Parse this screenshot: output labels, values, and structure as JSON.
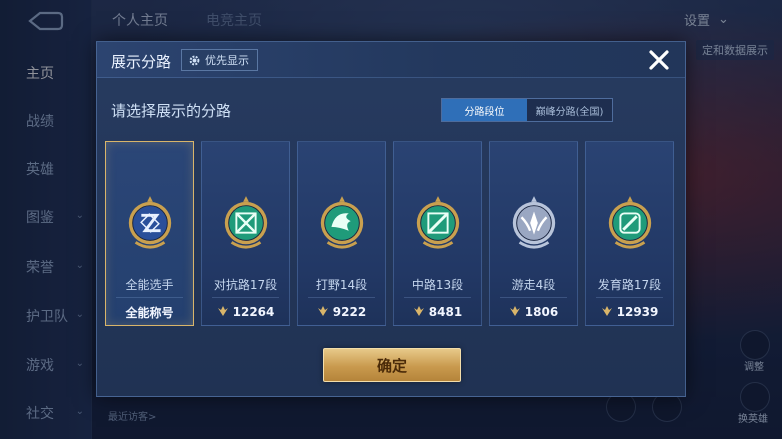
{
  "background": {
    "nav_items": [
      {
        "label": "主页",
        "active": true
      },
      {
        "label": "战绩",
        "active": false
      },
      {
        "label": "英雄",
        "active": false
      },
      {
        "label": "图鉴",
        "active": false,
        "chevron": "⌄"
      },
      {
        "label": "荣誉",
        "active": false,
        "chevron": "⌄"
      },
      {
        "label": "护卫队",
        "active": false,
        "chevron": "⌄"
      },
      {
        "label": "游戏",
        "active": false,
        "chevron": "⌄"
      },
      {
        "label": "社交",
        "active": false,
        "chevron": "⌄"
      }
    ],
    "top_tabs": [
      "个人主页",
      "电竞主页"
    ],
    "settings_label": "设置",
    "side_button_text": "定和数据展示",
    "recent_visitors": "最近访客>",
    "corner_labels": [
      "调整",
      "换英雄"
    ]
  },
  "modal": {
    "title": "展示分路",
    "priority_label": "优先显示",
    "subtitle": "请选择展示的分路",
    "tabs": [
      {
        "label": "分路段位",
        "active": true
      },
      {
        "label": "巅峰分路(全国)",
        "active": false
      }
    ],
    "cards": [
      {
        "label": "全能选手",
        "foot": "全能称号",
        "selected": true,
        "emblem": "all-rounder-emblem-icon"
      },
      {
        "label": "对抗路17段",
        "foot": "12264",
        "selected": false,
        "emblem": "clash-lane-emblem-icon"
      },
      {
        "label": "打野14段",
        "foot": "9222",
        "selected": false,
        "emblem": "jungle-emblem-icon"
      },
      {
        "label": "中路13段",
        "foot": "8481",
        "selected": false,
        "emblem": "mid-lane-emblem-icon"
      },
      {
        "label": "游走4段",
        "foot": "1806",
        "selected": false,
        "emblem": "roam-emblem-icon"
      },
      {
        "label": "发育路17段",
        "foot": "12939",
        "selected": false,
        "emblem": "farm-lane-emblem-icon"
      }
    ],
    "confirm_label": "确定"
  },
  "colors": {
    "accent_gold": "#d9b56a",
    "tab_active": "#2f6fb8",
    "emblem_green": "#1f9b7a",
    "emblem_silver": "#9aa7c2"
  }
}
